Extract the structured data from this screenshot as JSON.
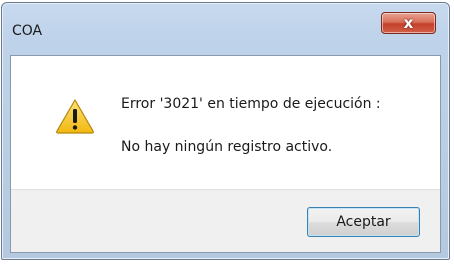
{
  "window": {
    "title": "COA",
    "close_symbol": "x"
  },
  "message": {
    "icon": "warning-icon",
    "line1": "Error '3021' en tiempo de ejecución :",
    "line2": "No hay ningún registro activo."
  },
  "buttons": {
    "ok_label": "Aceptar"
  },
  "colors": {
    "close_button": "#c4412a",
    "warning_fill": "#f6c517",
    "titlebar": "#c8daef"
  }
}
